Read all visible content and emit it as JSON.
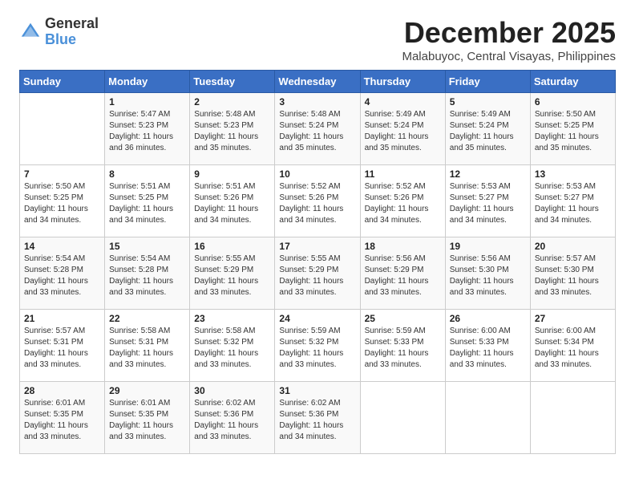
{
  "header": {
    "logo_general": "General",
    "logo_blue": "Blue",
    "month": "December 2025",
    "location": "Malabuyoc, Central Visayas, Philippines"
  },
  "days_of_week": [
    "Sunday",
    "Monday",
    "Tuesday",
    "Wednesday",
    "Thursday",
    "Friday",
    "Saturday"
  ],
  "weeks": [
    [
      {
        "day": "",
        "info": ""
      },
      {
        "day": "1",
        "info": "Sunrise: 5:47 AM\nSunset: 5:23 PM\nDaylight: 11 hours\nand 36 minutes."
      },
      {
        "day": "2",
        "info": "Sunrise: 5:48 AM\nSunset: 5:23 PM\nDaylight: 11 hours\nand 35 minutes."
      },
      {
        "day": "3",
        "info": "Sunrise: 5:48 AM\nSunset: 5:24 PM\nDaylight: 11 hours\nand 35 minutes."
      },
      {
        "day": "4",
        "info": "Sunrise: 5:49 AM\nSunset: 5:24 PM\nDaylight: 11 hours\nand 35 minutes."
      },
      {
        "day": "5",
        "info": "Sunrise: 5:49 AM\nSunset: 5:24 PM\nDaylight: 11 hours\nand 35 minutes."
      },
      {
        "day": "6",
        "info": "Sunrise: 5:50 AM\nSunset: 5:25 PM\nDaylight: 11 hours\nand 35 minutes."
      }
    ],
    [
      {
        "day": "7",
        "info": "Sunrise: 5:50 AM\nSunset: 5:25 PM\nDaylight: 11 hours\nand 34 minutes."
      },
      {
        "day": "8",
        "info": "Sunrise: 5:51 AM\nSunset: 5:25 PM\nDaylight: 11 hours\nand 34 minutes."
      },
      {
        "day": "9",
        "info": "Sunrise: 5:51 AM\nSunset: 5:26 PM\nDaylight: 11 hours\nand 34 minutes."
      },
      {
        "day": "10",
        "info": "Sunrise: 5:52 AM\nSunset: 5:26 PM\nDaylight: 11 hours\nand 34 minutes."
      },
      {
        "day": "11",
        "info": "Sunrise: 5:52 AM\nSunset: 5:26 PM\nDaylight: 11 hours\nand 34 minutes."
      },
      {
        "day": "12",
        "info": "Sunrise: 5:53 AM\nSunset: 5:27 PM\nDaylight: 11 hours\nand 34 minutes."
      },
      {
        "day": "13",
        "info": "Sunrise: 5:53 AM\nSunset: 5:27 PM\nDaylight: 11 hours\nand 34 minutes."
      }
    ],
    [
      {
        "day": "14",
        "info": "Sunrise: 5:54 AM\nSunset: 5:28 PM\nDaylight: 11 hours\nand 33 minutes."
      },
      {
        "day": "15",
        "info": "Sunrise: 5:54 AM\nSunset: 5:28 PM\nDaylight: 11 hours\nand 33 minutes."
      },
      {
        "day": "16",
        "info": "Sunrise: 5:55 AM\nSunset: 5:29 PM\nDaylight: 11 hours\nand 33 minutes."
      },
      {
        "day": "17",
        "info": "Sunrise: 5:55 AM\nSunset: 5:29 PM\nDaylight: 11 hours\nand 33 minutes."
      },
      {
        "day": "18",
        "info": "Sunrise: 5:56 AM\nSunset: 5:29 PM\nDaylight: 11 hours\nand 33 minutes."
      },
      {
        "day": "19",
        "info": "Sunrise: 5:56 AM\nSunset: 5:30 PM\nDaylight: 11 hours\nand 33 minutes."
      },
      {
        "day": "20",
        "info": "Sunrise: 5:57 AM\nSunset: 5:30 PM\nDaylight: 11 hours\nand 33 minutes."
      }
    ],
    [
      {
        "day": "21",
        "info": "Sunrise: 5:57 AM\nSunset: 5:31 PM\nDaylight: 11 hours\nand 33 minutes."
      },
      {
        "day": "22",
        "info": "Sunrise: 5:58 AM\nSunset: 5:31 PM\nDaylight: 11 hours\nand 33 minutes."
      },
      {
        "day": "23",
        "info": "Sunrise: 5:58 AM\nSunset: 5:32 PM\nDaylight: 11 hours\nand 33 minutes."
      },
      {
        "day": "24",
        "info": "Sunrise: 5:59 AM\nSunset: 5:32 PM\nDaylight: 11 hours\nand 33 minutes."
      },
      {
        "day": "25",
        "info": "Sunrise: 5:59 AM\nSunset: 5:33 PM\nDaylight: 11 hours\nand 33 minutes."
      },
      {
        "day": "26",
        "info": "Sunrise: 6:00 AM\nSunset: 5:33 PM\nDaylight: 11 hours\nand 33 minutes."
      },
      {
        "day": "27",
        "info": "Sunrise: 6:00 AM\nSunset: 5:34 PM\nDaylight: 11 hours\nand 33 minutes."
      }
    ],
    [
      {
        "day": "28",
        "info": "Sunrise: 6:01 AM\nSunset: 5:35 PM\nDaylight: 11 hours\nand 33 minutes."
      },
      {
        "day": "29",
        "info": "Sunrise: 6:01 AM\nSunset: 5:35 PM\nDaylight: 11 hours\nand 33 minutes."
      },
      {
        "day": "30",
        "info": "Sunrise: 6:02 AM\nSunset: 5:36 PM\nDaylight: 11 hours\nand 33 minutes."
      },
      {
        "day": "31",
        "info": "Sunrise: 6:02 AM\nSunset: 5:36 PM\nDaylight: 11 hours\nand 34 minutes."
      },
      {
        "day": "",
        "info": ""
      },
      {
        "day": "",
        "info": ""
      },
      {
        "day": "",
        "info": ""
      }
    ]
  ]
}
